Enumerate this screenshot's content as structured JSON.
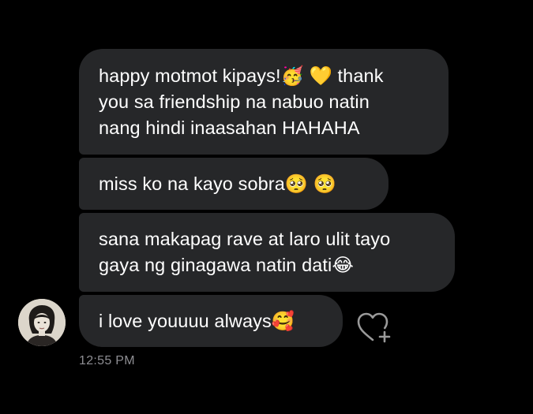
{
  "conversation": {
    "messages": [
      {
        "text": "happy motmot kipays!🥳 💛 thank\nyou sa friendship na nabuo natin\nnang hindi inaasahan HAHAHA"
      },
      {
        "text": "miss ko na kayo sobra🥺 🥺"
      },
      {
        "text": "sana makapag rave at laro ulit tayo\ngaya ng ginagawa natin dati😂"
      },
      {
        "text": "i love youuuu always🥰"
      }
    ],
    "timestamp": "12:55 PM",
    "avatar_icon": "user-avatar-icon",
    "react_icon": "heart-plus-icon"
  },
  "colors": {
    "background": "#000000",
    "bubble": "#262729",
    "text": "#ffffff",
    "timestamp": "#8e8e93",
    "react_icon": "#9a9a9a"
  }
}
